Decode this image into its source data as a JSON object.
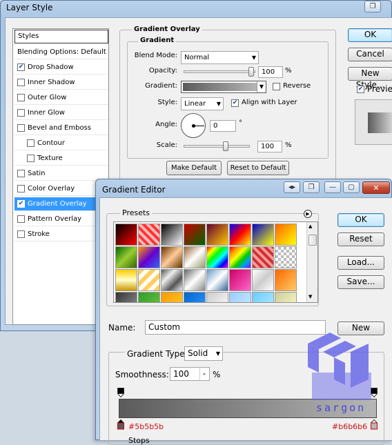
{
  "layer_style": {
    "title": "Layer Style",
    "list": {
      "header": "Styles",
      "items": [
        {
          "label": "Blending Options: Default",
          "checkbox": false
        },
        {
          "label": "Drop Shadow",
          "checkbox": true,
          "checked": true
        },
        {
          "label": "Inner Shadow",
          "checkbox": true,
          "checked": false
        },
        {
          "label": "Outer Glow",
          "checkbox": true,
          "checked": false
        },
        {
          "label": "Inner Glow",
          "checkbox": true,
          "checked": false
        },
        {
          "label": "Bevel and Emboss",
          "checkbox": true,
          "checked": false
        },
        {
          "label": "Contour",
          "checkbox": true,
          "checked": false,
          "indent": true
        },
        {
          "label": "Texture",
          "checkbox": true,
          "checked": false,
          "indent": true
        },
        {
          "label": "Satin",
          "checkbox": true,
          "checked": false
        },
        {
          "label": "Color Overlay",
          "checkbox": true,
          "checked": false
        },
        {
          "label": "Gradient Overlay",
          "checkbox": true,
          "checked": true,
          "selected": true
        },
        {
          "label": "Pattern Overlay",
          "checkbox": true,
          "checked": false
        },
        {
          "label": "Stroke",
          "checkbox": true,
          "checked": false
        }
      ]
    },
    "panel": {
      "title": "Gradient Overlay",
      "subtitle": "Gradient",
      "blend_mode_label": "Blend Mode:",
      "blend_mode_value": "Normal",
      "opacity_label": "Opacity:",
      "opacity_value": "100",
      "opacity_unit": "%",
      "gradient_label": "Gradient:",
      "reverse_label": "Reverse",
      "style_label": "Style:",
      "style_value": "Linear",
      "align_label": "Align with Layer",
      "angle_label": "Angle:",
      "angle_value": "0",
      "angle_unit": "°",
      "scale_label": "Scale:",
      "scale_value": "100",
      "scale_unit": "%",
      "make_default": "Make Default",
      "reset_default": "Reset to Default"
    },
    "buttons": {
      "ok": "OK",
      "cancel": "Cancel",
      "new_style": "New Style...",
      "preview": "Preview"
    }
  },
  "gradient_editor": {
    "title": "Gradient Editor",
    "presets_label": "Presets",
    "ok": "OK",
    "reset": "Reset",
    "load": "Load...",
    "save": "Save...",
    "name_label": "Name:",
    "name_value": "Custom",
    "new_label": "New",
    "gradient_type_label": "Gradient Type:",
    "gradient_type_value": "Solid",
    "smoothness_label": "Smoothness:",
    "smoothness_value": "100",
    "smoothness_unit": "%",
    "stops_label": "Stops",
    "stop_left_color": "#5b5b5b",
    "stop_right_color": "#b6b6b6"
  },
  "watermark": {
    "text": "sargon"
  },
  "colors": {
    "selection": "#3399ff",
    "gradient_start": "#5b5b5b",
    "gradient_end": "#b6b6b6",
    "hex_annotation": "#d01010"
  }
}
